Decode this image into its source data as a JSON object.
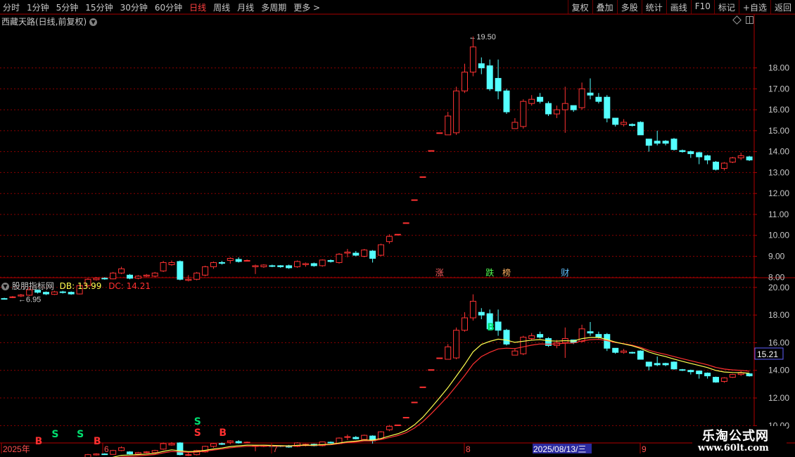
{
  "toolbar": {
    "periods": [
      "分时",
      "1分钟",
      "5分钟",
      "15分钟",
      "30分钟",
      "60分钟",
      "日线",
      "周线",
      "月线",
      "多周期",
      "更多 >"
    ],
    "active_period": "日线",
    "buttons": [
      "复权",
      "叠加",
      "多股",
      "统计",
      "画线",
      "F10",
      "标记",
      "+自选",
      "返回"
    ]
  },
  "upper": {
    "title": "西藏天路(日线,前复权)"
  },
  "lower": {
    "title": "股朋指标网",
    "db_label": "DB: 13.99",
    "dc_label": "DC: 14.21"
  },
  "cursor_value": "15.21",
  "logo": {
    "line1": "乐淘公式网",
    "line2": "www.60lt.com"
  },
  "colors": {
    "up": "#ff3232",
    "down": "#54ffff",
    "ma_yellow": "#ffff50",
    "ma_red": "#ff3030",
    "grid": "#8b0000"
  },
  "chart_data": [
    {
      "type": "candlestick",
      "title": "西藏天路(日线,前复权)",
      "ylim": [
        6.8,
        19.9
      ],
      "y_ticks": [
        8.0,
        9.0,
        10.0,
        11.0,
        12.0,
        13.0,
        14.0,
        15.0,
        16.0,
        17.0,
        18.0
      ],
      "annotations": [
        {
          "text": "19.50"
        },
        {
          "text": "6.95"
        }
      ],
      "event_markers": [
        "涨",
        "跌",
        "榜",
        "财"
      ],
      "candles": [
        [
          6.98,
          6.95,
          7.02,
          6.93
        ],
        [
          7.04,
          7.06,
          7.1,
          7.0
        ],
        [
          7.1,
          7.15,
          7.2,
          7.05
        ],
        [
          7.14,
          7.4,
          7.5,
          7.1
        ],
        [
          7.38,
          7.28,
          7.42,
          7.22
        ],
        [
          7.28,
          7.2,
          7.32,
          7.15
        ],
        [
          7.18,
          7.3,
          7.35,
          7.15
        ],
        [
          7.3,
          7.28,
          7.35,
          7.22
        ],
        [
          7.28,
          7.2,
          7.32,
          7.16
        ],
        [
          7.2,
          7.6,
          7.65,
          7.18
        ],
        [
          7.6,
          7.9,
          7.95,
          7.55
        ],
        [
          7.88,
          7.95,
          8.0,
          7.84
        ],
        [
          7.95,
          7.92,
          8.0,
          7.88
        ],
        [
          7.92,
          8.2,
          8.25,
          7.9
        ],
        [
          8.2,
          8.4,
          8.5,
          8.15
        ],
        [
          8.1,
          7.95,
          8.15,
          7.9
        ],
        [
          7.95,
          8.05,
          8.1,
          7.9
        ],
        [
          8.05,
          8.1,
          8.15,
          8.0
        ],
        [
          8.05,
          8.2,
          8.25,
          8.0
        ],
        [
          8.3,
          8.7,
          8.78,
          8.25
        ],
        [
          8.6,
          8.7,
          8.8,
          8.55
        ],
        [
          8.75,
          7.9,
          8.8,
          7.85
        ],
        [
          7.85,
          7.9,
          8.1,
          7.8
        ],
        [
          7.9,
          8.2,
          8.25,
          7.85
        ],
        [
          8.1,
          8.5,
          8.55,
          8.05
        ],
        [
          8.5,
          8.7,
          8.75,
          8.4
        ],
        [
          8.7,
          8.68,
          8.78,
          8.6
        ],
        [
          8.8,
          8.9,
          8.95,
          8.65
        ],
        [
          8.85,
          8.75,
          8.95,
          8.7
        ],
        [
          8.78,
          8.8,
          8.85,
          8.75
        ],
        [
          8.5,
          8.55,
          8.6,
          8.15
        ],
        [
          8.5,
          8.58,
          8.62,
          8.45
        ],
        [
          8.55,
          8.52,
          8.6,
          8.48
        ],
        [
          8.55,
          8.5,
          8.58,
          8.45
        ],
        [
          8.55,
          8.45,
          8.6,
          8.4
        ],
        [
          8.5,
          8.75,
          8.8,
          8.45
        ],
        [
          8.6,
          8.65,
          8.7,
          8.5
        ],
        [
          8.65,
          8.55,
          8.7,
          8.5
        ],
        [
          8.55,
          8.82,
          8.85,
          8.5
        ],
        [
          8.8,
          8.75,
          8.85,
          8.7
        ],
        [
          8.7,
          9.1,
          9.15,
          8.65
        ],
        [
          9.15,
          9.2,
          9.35,
          8.95
        ],
        [
          9.15,
          9.05,
          9.25,
          9.0
        ],
        [
          9.0,
          9.3,
          9.35,
          8.95
        ],
        [
          9.25,
          8.9,
          9.3,
          8.7
        ],
        [
          9.05,
          9.55,
          9.6,
          9.0
        ],
        [
          9.7,
          9.95,
          10.05,
          9.6
        ],
        [
          10.05,
          10.05,
          10.05,
          10.05
        ],
        [
          10.6,
          10.6,
          10.6,
          10.6
        ],
        [
          11.7,
          11.7,
          11.7,
          11.7
        ],
        [
          12.8,
          12.8,
          12.8,
          12.8
        ],
        [
          14.05,
          14.05,
          14.05,
          14.05
        ],
        [
          14.9,
          14.9,
          14.9,
          14.9
        ],
        [
          14.8,
          15.7,
          15.9,
          14.8
        ],
        [
          14.9,
          16.9,
          17.1,
          14.8
        ],
        [
          16.9,
          17.8,
          18.2,
          16.8
        ],
        [
          17.8,
          19.0,
          19.5,
          17.6
        ],
        [
          18.2,
          18.0,
          18.5,
          17.7
        ],
        [
          18.1,
          17.0,
          18.4,
          16.9
        ],
        [
          17.5,
          16.9,
          18.4,
          16.5
        ],
        [
          16.9,
          15.9,
          17.0,
          15.8
        ],
        [
          15.1,
          15.4,
          15.6,
          15.1
        ],
        [
          15.2,
          16.4,
          16.5,
          15.1
        ],
        [
          16.3,
          16.5,
          16.7,
          16.2
        ],
        [
          16.6,
          16.4,
          16.8,
          16.3
        ],
        [
          16.3,
          15.8,
          16.4,
          15.7
        ],
        [
          15.8,
          16.0,
          16.2,
          15.6
        ],
        [
          16.0,
          16.3,
          17.1,
          14.9
        ],
        [
          16.2,
          16.0,
          16.2,
          15.9
        ],
        [
          16.1,
          17.0,
          17.3,
          16.0
        ],
        [
          16.8,
          16.7,
          17.5,
          16.5
        ],
        [
          16.6,
          16.4,
          16.8,
          16.3
        ],
        [
          16.6,
          15.6,
          16.7,
          15.4
        ],
        [
          15.6,
          15.3,
          15.6,
          15.2
        ],
        [
          15.3,
          15.4,
          15.55,
          15.2
        ],
        [
          15.3,
          15.25,
          15.35,
          15.2
        ],
        [
          15.4,
          14.8,
          15.45,
          14.8
        ],
        [
          14.6,
          14.3,
          14.6,
          14.0
        ],
        [
          14.5,
          14.4,
          15.0,
          14.3
        ],
        [
          14.5,
          14.4,
          14.55,
          14.3
        ],
        [
          14.6,
          14.1,
          14.65,
          14.05
        ],
        [
          14.05,
          14.0,
          14.1,
          13.95
        ],
        [
          14.0,
          13.9,
          14.05,
          13.7
        ],
        [
          13.95,
          13.75,
          14.0,
          13.4
        ],
        [
          13.8,
          13.6,
          13.85,
          13.4
        ],
        [
          13.5,
          13.15,
          13.55,
          13.1
        ],
        [
          13.2,
          13.45,
          13.5,
          13.1
        ],
        [
          13.5,
          13.7,
          13.75,
          13.45
        ],
        [
          13.7,
          13.8,
          13.95,
          13.6
        ],
        [
          13.75,
          13.6,
          13.8,
          13.55
        ]
      ]
    },
    {
      "type": "candlestick",
      "title": "股朋指标网",
      "ylim": [
        8.9,
        20.6
      ],
      "y_ticks": [
        10.0,
        12.0,
        14.0,
        16.0,
        18.0,
        20.0
      ],
      "series": [
        {
          "name": "DB",
          "last": 13.99
        },
        {
          "name": "DC",
          "last": 14.21
        }
      ],
      "signals": [
        "S",
        "B",
        "S",
        "B",
        "B",
        "S",
        "B",
        "S"
      ]
    }
  ],
  "x_axis": {
    "labels": [
      "2025年",
      "6",
      "7",
      "8",
      "2025/08/13/三",
      "9"
    ]
  }
}
